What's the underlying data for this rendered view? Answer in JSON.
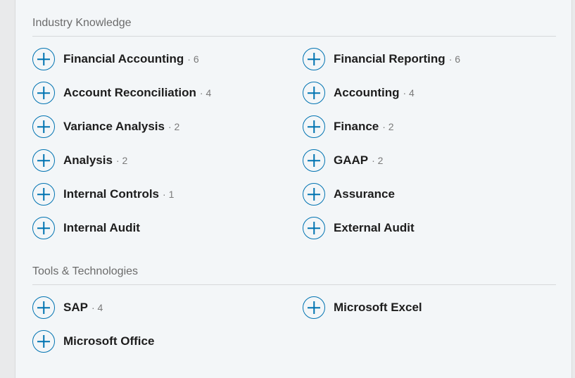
{
  "sections": [
    {
      "heading": "Industry Knowledge",
      "skills": [
        {
          "name": "Financial Accounting",
          "count": "· 6"
        },
        {
          "name": "Financial Reporting",
          "count": "· 6"
        },
        {
          "name": "Account Reconciliation",
          "count": "· 4"
        },
        {
          "name": "Accounting",
          "count": "· 4"
        },
        {
          "name": "Variance Analysis",
          "count": "· 2"
        },
        {
          "name": "Finance",
          "count": "· 2"
        },
        {
          "name": "Analysis",
          "count": "· 2"
        },
        {
          "name": "GAAP",
          "count": "· 2"
        },
        {
          "name": "Internal Controls",
          "count": "· 1"
        },
        {
          "name": "Assurance",
          "count": ""
        },
        {
          "name": "Internal Audit",
          "count": ""
        },
        {
          "name": "External Audit",
          "count": ""
        }
      ]
    },
    {
      "heading": "Tools & Technologies",
      "skills": [
        {
          "name": "SAP",
          "count": "· 4"
        },
        {
          "name": "Microsoft Excel",
          "count": ""
        },
        {
          "name": "Microsoft Office",
          "count": ""
        }
      ]
    }
  ],
  "icons": {
    "add": "plus-circle-icon"
  },
  "colors": {
    "accent": "#0073b1",
    "heading": "#6b6b6b",
    "skill_text": "#1d1d1d",
    "count_text": "#7a7a7a",
    "panel_bg": "#f3f6f8"
  }
}
